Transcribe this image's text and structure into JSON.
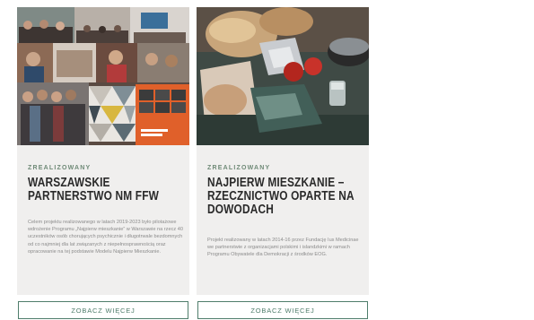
{
  "cards": [
    {
      "status": "ZREALIZOWANY",
      "title": "WARSZAWSKIE PARTNERSTWO NM FFW",
      "description": "Celem projektu realizowanego w latach 2019-2023 było pilotażowe wdrożenie Programu „Najpierw mieszkanie” w Warszawie na rzecz 40 uczestników osób chorujących psychicznie i długotrwale bezdomnych od co najmniej dla lat związanych z niepełnosprawnością oraz opracowanie na tej podstawie Modelu Najpierw Mieszkanie.",
      "button": "ZOBACZ WIĘCEJ",
      "image_alt": "collage of meeting photos and team"
    },
    {
      "status": "ZREALIZOWANY",
      "title": "NAJPIERW MIESZKANIE – RZECZNICTWO OPARTE NA DOWODACH",
      "description": "Projekt realizowany w latach 2014-16 przez Fundację Ius Medicinae we partnerstwie z organizacjami polskimi i islandzkimi w ramach Programu Obywatele dla Demokracji z środków EOG.",
      "button": "ZOBACZ WIĘCEJ",
      "image_alt": "food packages on a table"
    }
  ],
  "colors": {
    "accent": "#4f7d6b",
    "status": "#6f8a77",
    "card_bg": "#f0efee",
    "text": "#2a2a2a"
  }
}
